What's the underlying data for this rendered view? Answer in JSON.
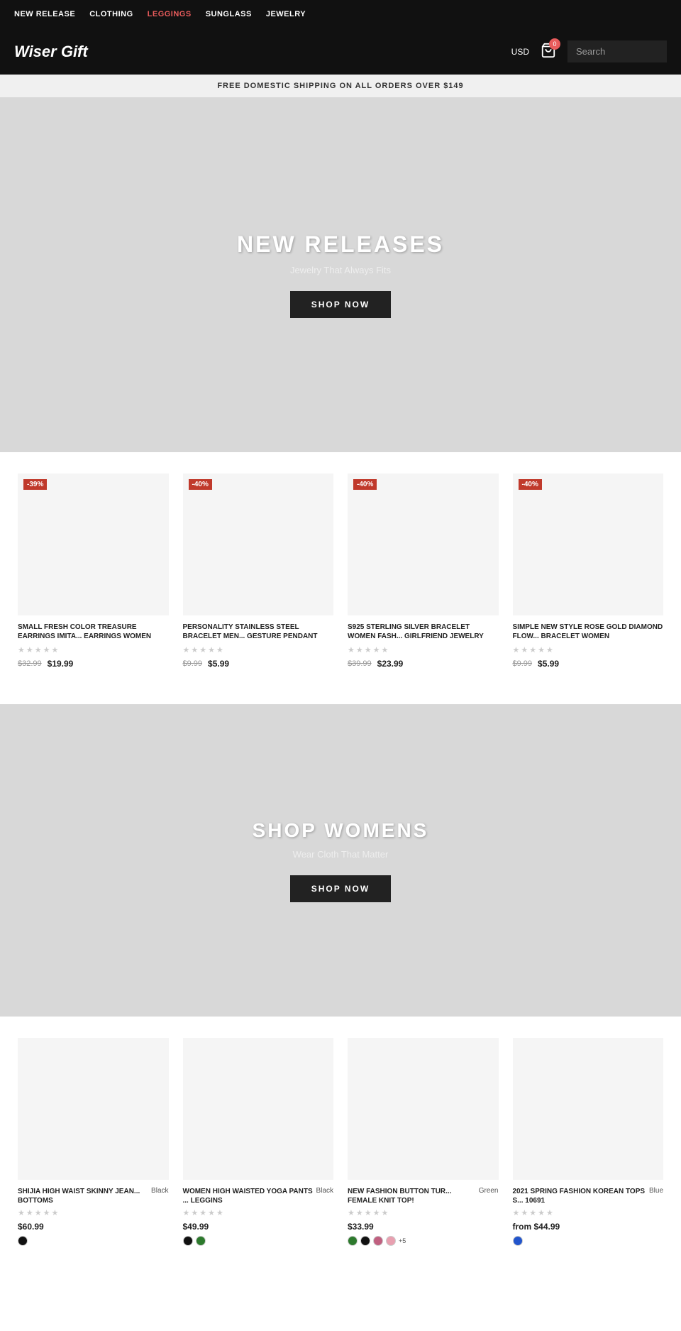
{
  "site": {
    "name": "Wiser Gift"
  },
  "topnav": {
    "items": [
      {
        "label": "NEW RELEASE",
        "id": "new-release",
        "active": false
      },
      {
        "label": "CLOTHING",
        "id": "clothing",
        "active": false
      },
      {
        "label": "LEGGINGS",
        "id": "leggings",
        "active": true
      },
      {
        "label": "SUNGLASS",
        "id": "sunglass",
        "active": false
      },
      {
        "label": "JEWELRY",
        "id": "jewelry",
        "active": false
      }
    ]
  },
  "header": {
    "currency": "USD",
    "cart_count": "0",
    "search_placeholder": "Search"
  },
  "shipping_banner": "FREE DOMESTIC SHIPPING ON ALL ORDERS OVER $149",
  "hero1": {
    "title": "NEW RELEASES",
    "subtitle": "Jewelry That Always Fits",
    "button": "SHOP NOW"
  },
  "jewelry_products": [
    {
      "name": "SMALL FRESH COLOR TREASURE EARRINGS IMITA... EARRINGS WOMEN",
      "discount": "-39%",
      "price_old": "$32.99",
      "price_new": "$19.99",
      "stars": 5
    },
    {
      "name": "PERSONALITY STAINLESS STEEL BRACELET MEN... GESTURE PENDANT",
      "discount": "-40%",
      "price_old": "$9.99",
      "price_new": "$5.99",
      "stars": 5
    },
    {
      "name": "S925 STERLING SILVER BRACELET WOMEN FASH... GIRLFRIEND JEWELRY",
      "discount": "-40%",
      "price_old": "$39.99",
      "price_new": "$23.99",
      "stars": 5
    },
    {
      "name": "SIMPLE NEW STYLE ROSE GOLD DIAMOND FLOW... BRACELET WOMEN",
      "discount": "-40%",
      "price_old": "$9.99",
      "price_new": "$5.99",
      "stars": 5
    }
  ],
  "hero2": {
    "title": "SHOP WOMENS",
    "subtitle": "Wear Cloth That Matter",
    "button": "SHOP NOW"
  },
  "clothing_products": [
    {
      "name": "SHIJIA HIGH WAIST SKINNY JEAN... BOTTOMS",
      "color": "Black",
      "price": "$60.99",
      "from": false,
      "swatches": [
        "#111"
      ]
    },
    {
      "name": "WOMEN HIGH WAISTED YOGA PANTS ... LEGGINS",
      "color": "Black",
      "price": "$49.99",
      "from": false,
      "swatches": [
        "#111",
        "#2d7a2d"
      ]
    },
    {
      "name": "NEW FASHION BUTTON TUR... FEMALE KNIT TOP!",
      "color": "Green",
      "price": "$33.99",
      "from": false,
      "swatches": [
        "#2d7a2d",
        "#111",
        "#c06080",
        "#e8a0b0"
      ],
      "extra": "+5"
    },
    {
      "name": "2021 SPRING FASHION KOREAN TOPS S... 10691",
      "color": "Blue",
      "price": "from $44.99",
      "from": true,
      "swatches": [
        "#2255cc"
      ]
    }
  ]
}
